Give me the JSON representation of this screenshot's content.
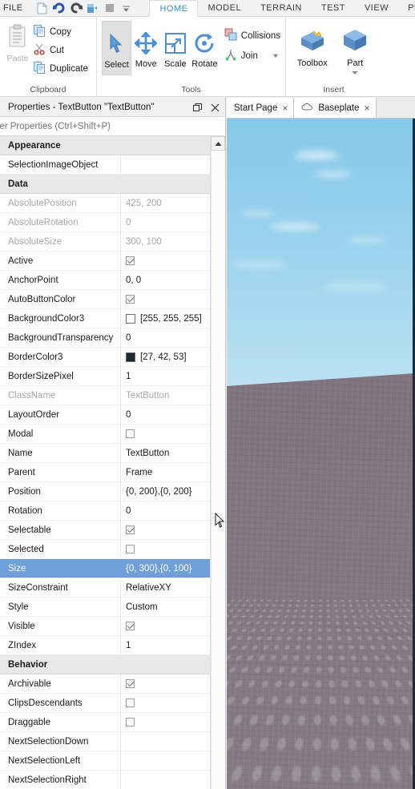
{
  "app": {
    "file_menu": "FILE",
    "quick_access": [
      {
        "name": "new-document-icon",
        "label": "New"
      },
      {
        "name": "undo-icon",
        "label": "Undo"
      },
      {
        "name": "redo-icon",
        "label": "Redo"
      },
      {
        "name": "play-icon",
        "label": "Play"
      },
      {
        "name": "stop-icon",
        "label": "Stop"
      },
      {
        "name": "customize-caret-icon",
        "label": "Customize"
      }
    ],
    "tabs": [
      {
        "label": "HOME",
        "active": true
      },
      {
        "label": "MODEL",
        "active": false
      },
      {
        "label": "TERRAIN",
        "active": false
      },
      {
        "label": "TEST",
        "active": false
      },
      {
        "label": "VIEW",
        "active": false
      },
      {
        "label": "PLUGINS",
        "active": false
      }
    ],
    "accent_color": "#3a8cc8"
  },
  "ribbon": {
    "clipboard": {
      "group_label": "Clipboard",
      "paste_label": "Paste",
      "items": [
        {
          "label": "Copy",
          "icon": "copy-icon"
        },
        {
          "label": "Cut",
          "icon": "cut-icon"
        },
        {
          "label": "Duplicate",
          "icon": "duplicate-icon"
        }
      ]
    },
    "tools": {
      "group_label": "Tools",
      "buttons": [
        {
          "label": "Select",
          "icon": "cursor-arrow-icon",
          "selected": true
        },
        {
          "label": "Move",
          "icon": "move-arrows-icon",
          "selected": false
        },
        {
          "label": "Scale",
          "icon": "scale-square-icon",
          "selected": false
        },
        {
          "label": "Rotate",
          "icon": "rotate-arc-icon",
          "selected": false
        }
      ],
      "toggles": [
        {
          "label": "Collisions",
          "icon": "collisions-icon"
        },
        {
          "label": "Join",
          "icon": "join-icon"
        }
      ],
      "overflow_caret": "caret-down-icon"
    },
    "insert": {
      "group_label": "Insert",
      "buttons": [
        {
          "label": "Toolbox",
          "icon": "toolbox-icon"
        },
        {
          "label": "Part",
          "icon": "part-cube-icon",
          "has_caret": true
        }
      ]
    }
  },
  "properties_panel": {
    "title": "Properties - TextButton \"TextButton\"",
    "float_button": "float-icon",
    "close_button": "close-icon",
    "filter_placeholder": "Filter Properties (Ctrl+Shift+P)",
    "filter_value": "",
    "rows": [
      {
        "type": "category",
        "name": "Appearance"
      },
      {
        "type": "prop",
        "name": "SelectionImageObject",
        "value": "",
        "kind": "text",
        "dim": false
      },
      {
        "type": "category",
        "name": "Data"
      },
      {
        "type": "prop",
        "name": "AbsolutePosition",
        "value": "425, 200",
        "kind": "text",
        "dim": true
      },
      {
        "type": "prop",
        "name": "AbsoluteRotation",
        "value": "0",
        "kind": "text",
        "dim": true
      },
      {
        "type": "prop",
        "name": "AbsoluteSize",
        "value": "300, 100",
        "kind": "text",
        "dim": true
      },
      {
        "type": "prop",
        "name": "Active",
        "value": "",
        "kind": "checkbox",
        "checked": true
      },
      {
        "type": "prop",
        "name": "AnchorPoint",
        "value": "0, 0",
        "kind": "text",
        "dim": false
      },
      {
        "type": "prop",
        "name": "AutoButtonColor",
        "value": "",
        "kind": "checkbox",
        "checked": true
      },
      {
        "type": "prop",
        "name": "BackgroundColor3",
        "value": "[255, 255, 255]",
        "kind": "color",
        "swatch": "#ffffff"
      },
      {
        "type": "prop",
        "name": "BackgroundTransparency",
        "value": "0",
        "kind": "text",
        "dim": false
      },
      {
        "type": "prop",
        "name": "BorderColor3",
        "value": "[27, 42, 53]",
        "kind": "color",
        "swatch": "#1b2a35"
      },
      {
        "type": "prop",
        "name": "BorderSizePixel",
        "value": "1",
        "kind": "text",
        "dim": false
      },
      {
        "type": "prop",
        "name": "ClassName",
        "value": "TextButton",
        "kind": "text",
        "dim": true
      },
      {
        "type": "prop",
        "name": "LayoutOrder",
        "value": "0",
        "kind": "text",
        "dim": false
      },
      {
        "type": "prop",
        "name": "Modal",
        "value": "",
        "kind": "checkbox",
        "checked": false
      },
      {
        "type": "prop",
        "name": "Name",
        "value": "TextButton",
        "kind": "text",
        "dim": false
      },
      {
        "type": "prop",
        "name": "Parent",
        "value": "Frame",
        "kind": "text",
        "dim": false
      },
      {
        "type": "prop",
        "name": "Position",
        "value": "{0, 200},{0, 200}",
        "kind": "text",
        "dim": false
      },
      {
        "type": "prop",
        "name": "Rotation",
        "value": "0",
        "kind": "text",
        "dim": false
      },
      {
        "type": "prop",
        "name": "Selectable",
        "value": "",
        "kind": "checkbox",
        "checked": true
      },
      {
        "type": "prop",
        "name": "Selected",
        "value": "",
        "kind": "checkbox",
        "checked": false
      },
      {
        "type": "prop",
        "name": "Size",
        "value": "{0, 300},{0, 100}",
        "kind": "text",
        "dim": false,
        "selected": true
      },
      {
        "type": "prop",
        "name": "SizeConstraint",
        "value": "RelativeXY",
        "kind": "text",
        "dim": false
      },
      {
        "type": "prop",
        "name": "Style",
        "value": "Custom",
        "kind": "text",
        "dim": false
      },
      {
        "type": "prop",
        "name": "Visible",
        "value": "",
        "kind": "checkbox",
        "checked": true
      },
      {
        "type": "prop",
        "name": "ZIndex",
        "value": "1",
        "kind": "text",
        "dim": false
      },
      {
        "type": "category",
        "name": "Behavior"
      },
      {
        "type": "prop",
        "name": "Archivable",
        "value": "",
        "kind": "checkbox",
        "checked": true
      },
      {
        "type": "prop",
        "name": "ClipsDescendants",
        "value": "",
        "kind": "checkbox",
        "checked": false
      },
      {
        "type": "prop",
        "name": "Draggable",
        "value": "",
        "kind": "checkbox",
        "checked": false
      },
      {
        "type": "prop",
        "name": "NextSelectionDown",
        "value": "",
        "kind": "text",
        "dim": false
      },
      {
        "type": "prop",
        "name": "NextSelectionLeft",
        "value": "",
        "kind": "text",
        "dim": false
      },
      {
        "type": "prop",
        "name": "NextSelectionRight",
        "value": "",
        "kind": "text",
        "dim": false
      }
    ],
    "selection_color": "#6e9fd8"
  },
  "viewport": {
    "tabs": [
      {
        "label": "Start Page",
        "icon": null,
        "active": true,
        "close": "×"
      },
      {
        "label": "Baseplate",
        "icon": "cloud-icon",
        "active": true,
        "close": "×"
      }
    ],
    "scene": {
      "sky_top_color": "#86c9e9",
      "sky_bottom_color": "#c2e3f3",
      "ground_color": "#7f757e",
      "description": "Baseplate with studs under a blue sky"
    }
  }
}
